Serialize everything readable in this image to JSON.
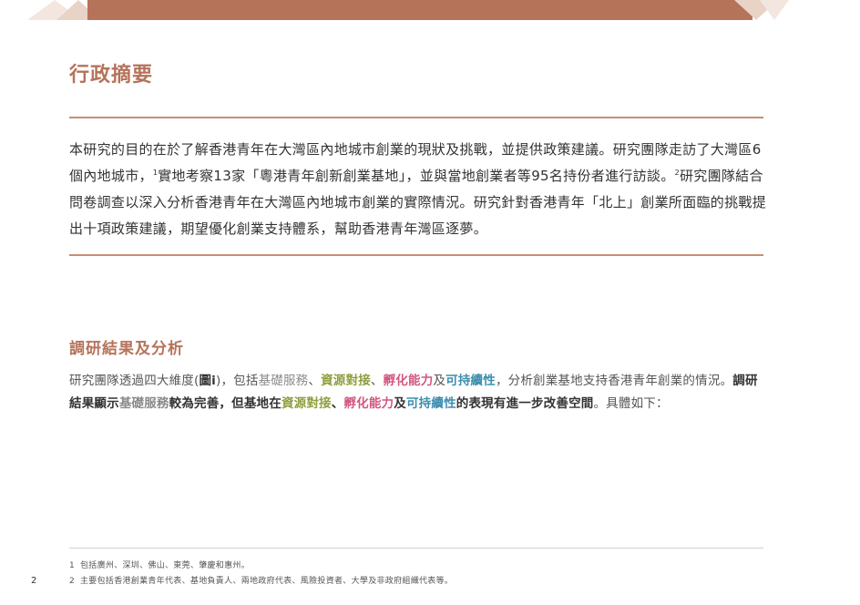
{
  "colors": {
    "banner": "#b5735a",
    "heading": "#b5735a",
    "rule": "#c98e73",
    "basic_services": "#8a8a8a",
    "resource_matching": "#8e9e3c",
    "incubation": "#d2577f",
    "sustainability": "#3d8fb0"
  },
  "heading": "行政摘要",
  "summary": {
    "s1": "本研究的目的在於了解香港青年在大灣區內地城市創業的現狀及挑戰，並提供政策建議。研究團隊走訪了大灣區6個內地城市，",
    "fn1": "1",
    "s2": "實地考察13家「粵港青年創新創業基地」，並與當地創業者等95名持份者進行訪談。",
    "fn2": "2",
    "s3": "研究團隊結合問卷調查以深入分析香港青年在大灣區內地城市創業的實際情況。研究針對香港青年「北上」創業所面臨的挑戰提出十項政策建議，期望優化創業支持體系，幫助香港青年灣區逐夢。"
  },
  "subheading": "調研結果及分析",
  "analysis": {
    "p1": "研究團隊透過四大維度(",
    "fig_ref": "圖i",
    "p2": ")，包括",
    "basic": "基礎服務",
    "sep1": "、",
    "resource": "資源對接",
    "sep2": "、",
    "incubation": "孵化能力",
    "and1": "及",
    "sustain": "可持續性",
    "p3": "，分析創業基地支持香港青年創業的情況。",
    "b1": "調研結果顯示",
    "basic2": "基礎服務",
    "b2": "較為完善，但基地在",
    "resource2": "資源對接",
    "sep3": "、",
    "incubation2": "孵化能力",
    "and2": "及",
    "sustain2": "可持續性",
    "b3": "的表現有進一步改善空間",
    "p4": "。具體如下："
  },
  "footnotes": [
    {
      "num": "1",
      "text": "包括廣州、深圳、佛山、東莞、肇慶和惠州。"
    },
    {
      "num": "2",
      "text": "主要包括香港創業青年代表、基地負責人、兩地政府代表、風險投資者、大學及非政府組織代表等。"
    }
  ],
  "page_number": "2"
}
